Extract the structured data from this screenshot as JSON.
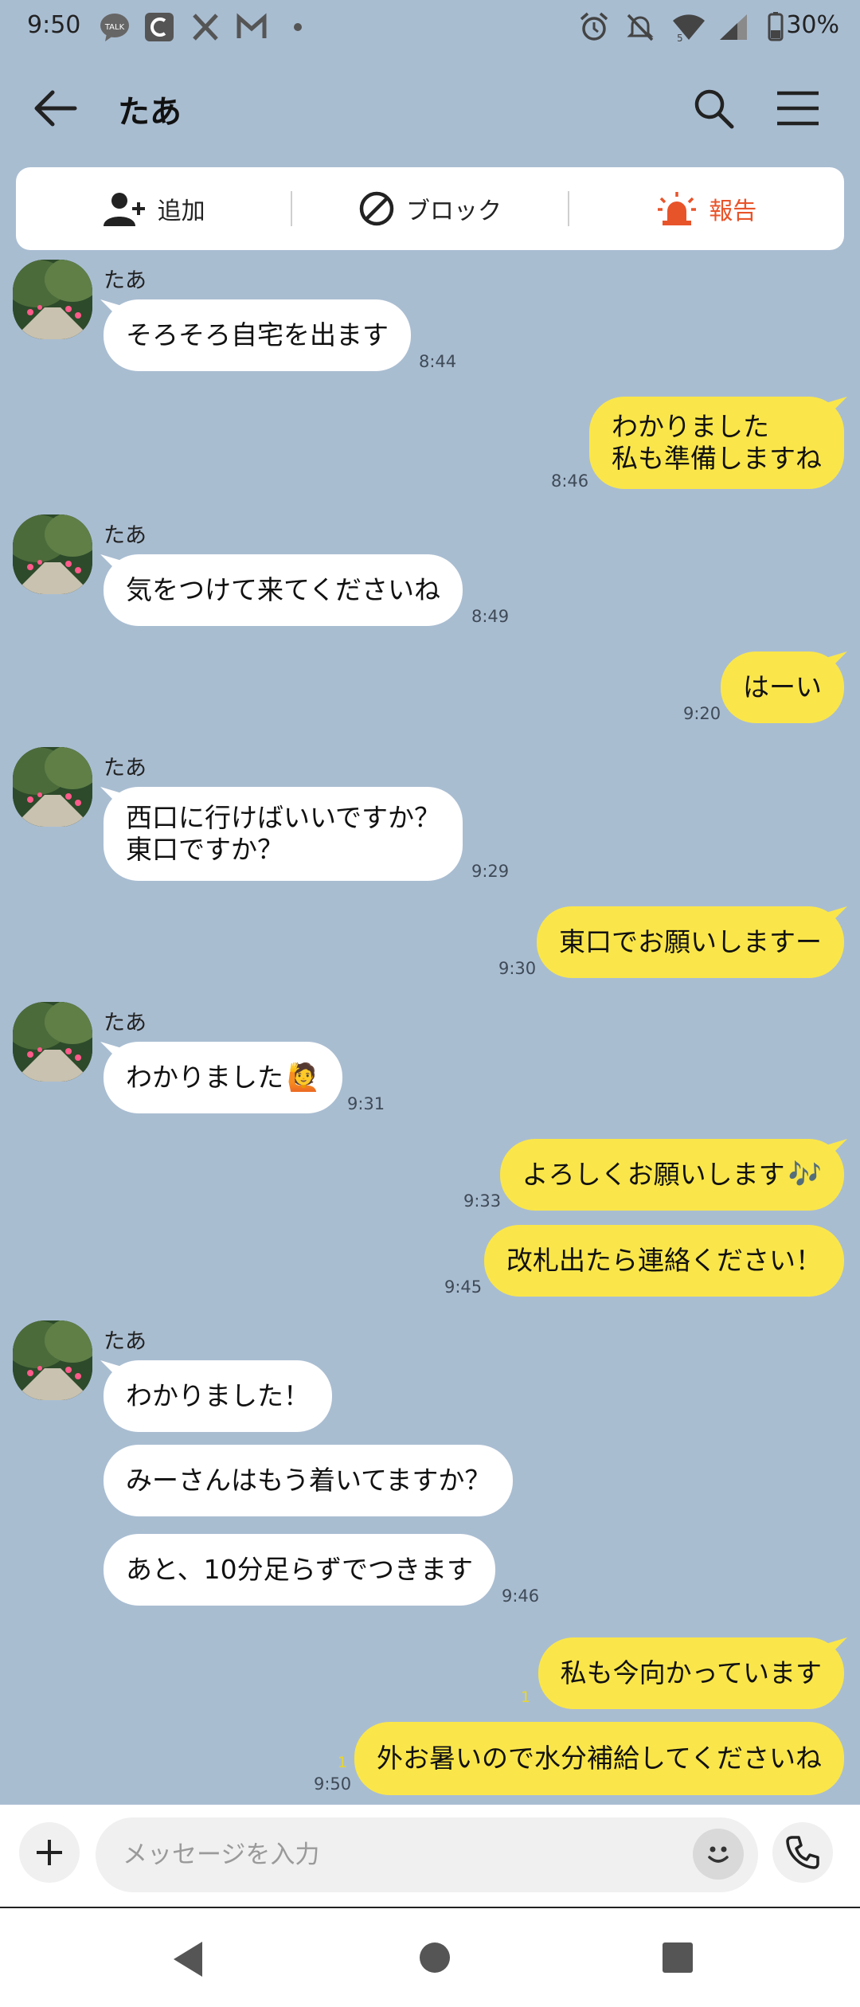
{
  "status_bar": {
    "time": "9:50",
    "battery": "30%",
    "icons": [
      "talk-icon",
      "c-app-icon",
      "x-icon",
      "gmail-icon",
      "dot-icon",
      "alarm-icon",
      "mute-icon",
      "wifi-icon",
      "signal-icon",
      "battery-icon"
    ]
  },
  "header": {
    "title": "たあ"
  },
  "action_bar": {
    "add_label": "追加",
    "block_label": "ブロック",
    "report_label": "報告",
    "report_color": "#e8542a"
  },
  "messages": [
    {
      "from": "in",
      "sender": "たあ",
      "text": "そろそろ自宅を出ます",
      "time": "8:44"
    },
    {
      "from": "out",
      "text": "わかりました\n私も準備しますね",
      "time": "8:46"
    },
    {
      "from": "in",
      "sender": "たあ",
      "text": "気をつけて来てくださいね",
      "time": "8:49"
    },
    {
      "from": "out",
      "text": "はーい",
      "time": "9:20"
    },
    {
      "from": "in",
      "sender": "たあ",
      "text": "西口に行けばいいですか？\n東口ですか？",
      "time": "9:29"
    },
    {
      "from": "out",
      "text": "東口でお願いしますー",
      "time": "9:30"
    },
    {
      "from": "in",
      "sender": "たあ",
      "text": "わかりました",
      "emoji": "🙋",
      "time": "9:31"
    },
    {
      "from": "out",
      "text": "よろしくお願いします",
      "emoji": "🎶",
      "time": "9:33"
    },
    {
      "from": "out",
      "text": "改札出たら連絡ください！",
      "time": "9:45"
    },
    {
      "from": "in",
      "sender": "たあ",
      "text": "わかりました！"
    },
    {
      "from": "in",
      "text": "みーさんはもう着いてますか？"
    },
    {
      "from": "in",
      "text": "あと、10分足らずでつきます",
      "time": "9:46"
    },
    {
      "from": "out",
      "text": "私も今向かっています",
      "read": "1"
    },
    {
      "from": "out",
      "text": "外お暑いので水分補給してくださいね",
      "read": "1",
      "time": "9:50"
    }
  ],
  "input_bar": {
    "placeholder": "メッセージを入力"
  },
  "colors": {
    "background": "#a9bdd1",
    "outgoing_bubble": "#fae64a",
    "incoming_bubble": "#ffffff"
  }
}
